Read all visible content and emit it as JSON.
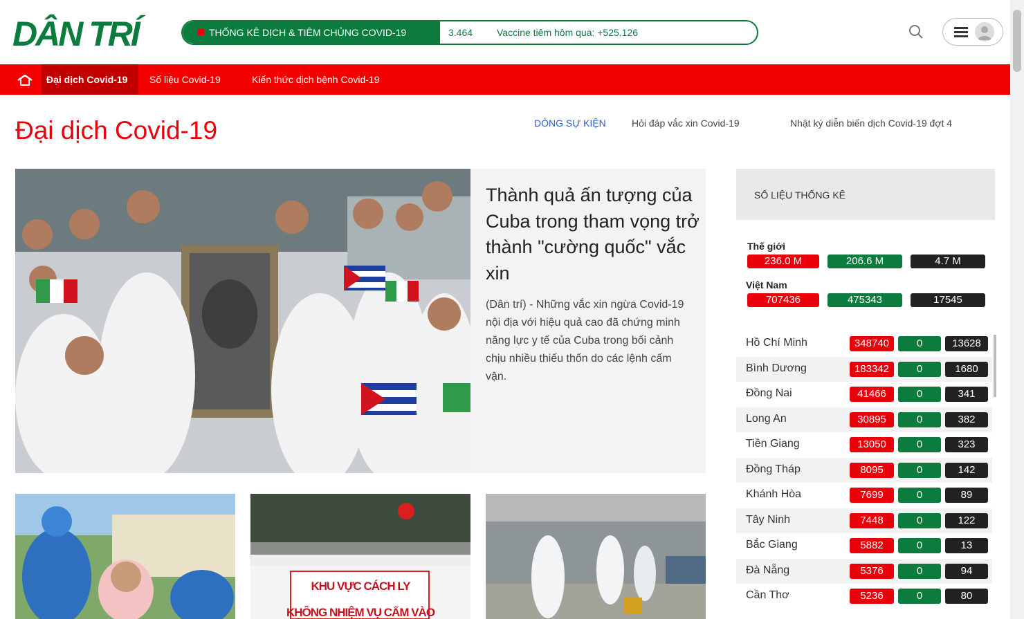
{
  "header": {
    "logo": "DÂN TRÍ",
    "ticker_label": "THỐNG KÊ DỊCH & TIÊM CHỦNG COVID-19",
    "ticker_count": "3.464",
    "ticker_vaccine": "Vaccine tiêm hôm qua: +525.126"
  },
  "nav": {
    "items": [
      "Đại dịch Covid-19",
      "Số liệu Covid-19",
      "Kiến thức dịch bệnh Covid-19"
    ]
  },
  "section": {
    "title": "Đại dịch Covid-19",
    "events_label": "DÒNG SỰ KIỆN",
    "events": [
      "Hỏi đáp vắc xin Covid-19",
      "Nhật ký diễn biến dịch Covid-19 đợt 4"
    ]
  },
  "featured": {
    "title": "Thành quả ấn tượng của Cuba trong tham vọng trở thành \"cường quốc\" vắc xin",
    "sapo": "(Dân trí) - Những vắc xin ngừa Covid-19 nội địa với hiệu quả cao đã chứng minh năng lực y tế của Cuba trong bối cảnh chịu nhiều thiếu thốn do các lệnh cấm vận."
  },
  "cards": [
    {
      "sign_1": "",
      "sign_2": ""
    },
    {
      "sign_1": "KHU VỰC CÁCH LY",
      "sign_2": "KHÔNG NHIỆM VỤ CẤM VÀO"
    },
    {
      "sign_1": "",
      "sign_2": ""
    }
  ],
  "stats": {
    "heading": "SỐ LIỆU THỐNG KÊ",
    "world_label": "Thế giới",
    "world": {
      "cases": "236.0 M",
      "recovered": "206.6 M",
      "deaths": "4.7 M"
    },
    "vn_label": "Việt Nam",
    "vn": {
      "cases": "707436",
      "recovered": "475343",
      "deaths": "17545"
    },
    "provinces": [
      {
        "name": "Hồ Chí Minh",
        "cases": "348740",
        "recovered": "0",
        "deaths": "13628"
      },
      {
        "name": "Bình Dương",
        "cases": "183342",
        "recovered": "0",
        "deaths": "1680"
      },
      {
        "name": "Đồng Nai",
        "cases": "41466",
        "recovered": "0",
        "deaths": "341"
      },
      {
        "name": "Long An",
        "cases": "30895",
        "recovered": "0",
        "deaths": "382"
      },
      {
        "name": "Tiền Giang",
        "cases": "13050",
        "recovered": "0",
        "deaths": "323"
      },
      {
        "name": "Đồng Tháp",
        "cases": "8095",
        "recovered": "0",
        "deaths": "142"
      },
      {
        "name": "Khánh Hòa",
        "cases": "7699",
        "recovered": "0",
        "deaths": "89"
      },
      {
        "name": "Tây Ninh",
        "cases": "7448",
        "recovered": "0",
        "deaths": "122"
      },
      {
        "name": "Bắc Giang",
        "cases": "5882",
        "recovered": "0",
        "deaths": "13"
      },
      {
        "name": "Đà Nẵng",
        "cases": "5376",
        "recovered": "0",
        "deaths": "94"
      },
      {
        "name": "Cần Thơ",
        "cases": "5236",
        "recovered": "0",
        "deaths": "80"
      }
    ]
  },
  "colors": {
    "brand_green": "#0b7c3e",
    "brand_red": "#e8000b",
    "nav_red": "#f30000"
  }
}
